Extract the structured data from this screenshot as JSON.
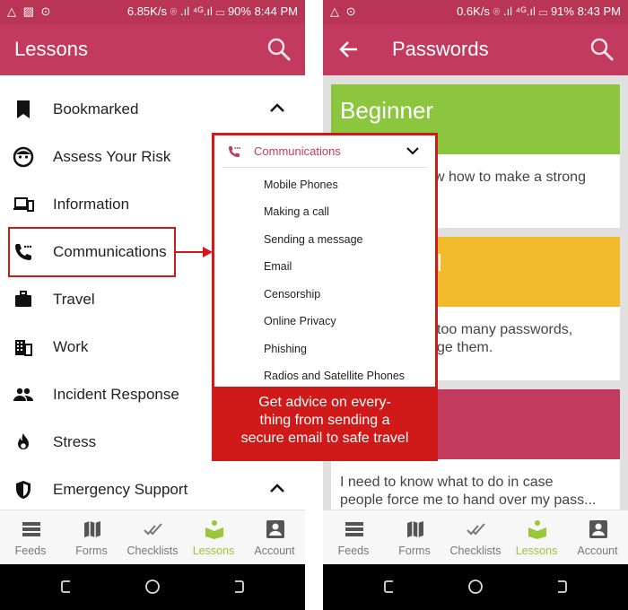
{
  "left_screen": {
    "status": {
      "left": "△ ▨ ⊙",
      "right": "6.85K/s ⌾ .ıl ⁴ᴳ.ıl ▭ 90% 8:44 PM"
    },
    "title": "Lessons",
    "menu": [
      {
        "label": "Bookmarked",
        "icon": "bookmark-icon",
        "chevron": "up"
      },
      {
        "label": "Assess Your Risk",
        "icon": "face-icon"
      },
      {
        "label": "Information",
        "icon": "devices-icon"
      },
      {
        "label": "Communications",
        "icon": "phone-icon"
      },
      {
        "label": "Travel",
        "icon": "briefcase-icon"
      },
      {
        "label": "Work",
        "icon": "building-icon"
      },
      {
        "label": "Incident Response",
        "icon": "people-icon"
      },
      {
        "label": "Stress",
        "icon": "flame-icon"
      },
      {
        "label": "Emergency Support",
        "icon": "shield-icon",
        "chevron": "up"
      }
    ]
  },
  "callout": {
    "header": "Communications",
    "items": [
      "Mobile Phones",
      "Making a call",
      "Sending a message",
      "Email",
      "Censorship",
      "Online Privacy",
      "Phishing",
      "Radios and Satellite Phones"
    ],
    "banner_lines": [
      "Get advice on every-",
      "thing from sending a",
      "secure email to safe travel"
    ]
  },
  "right_screen": {
    "status": {
      "left": "△ ⊙",
      "right": "0.6K/s ⌾ .ıl ⁴ᴳ.ıl ▭ 91% 8:43 PM"
    },
    "title": "Passwords",
    "cards": [
      {
        "title": "Beginner",
        "color": "#8cc63f",
        "line1": "w how to make a strong",
        "line2": ""
      },
      {
        "title": "l",
        "color": "#f2bb2c",
        "line1": "too many passwords,",
        "line2": "ge them."
      },
      {
        "title": "",
        "color": "#c23b5f",
        "line1": "I need to know what to do in case",
        "line2": "people force me to hand over my pass..."
      }
    ]
  },
  "bottom_nav": [
    {
      "label": "Feeds",
      "icon": "feeds-icon"
    },
    {
      "label": "Forms",
      "icon": "map-icon"
    },
    {
      "label": "Checklists",
      "icon": "checks-icon"
    },
    {
      "label": "Lessons",
      "icon": "lessons-icon",
      "active": true
    },
    {
      "label": "Account",
      "icon": "account-icon"
    }
  ],
  "colors": {
    "app_bar": "#c23b5f",
    "status_bar": "#b83555",
    "highlight": "#d01a1a",
    "active_tab": "#9ac63a"
  }
}
